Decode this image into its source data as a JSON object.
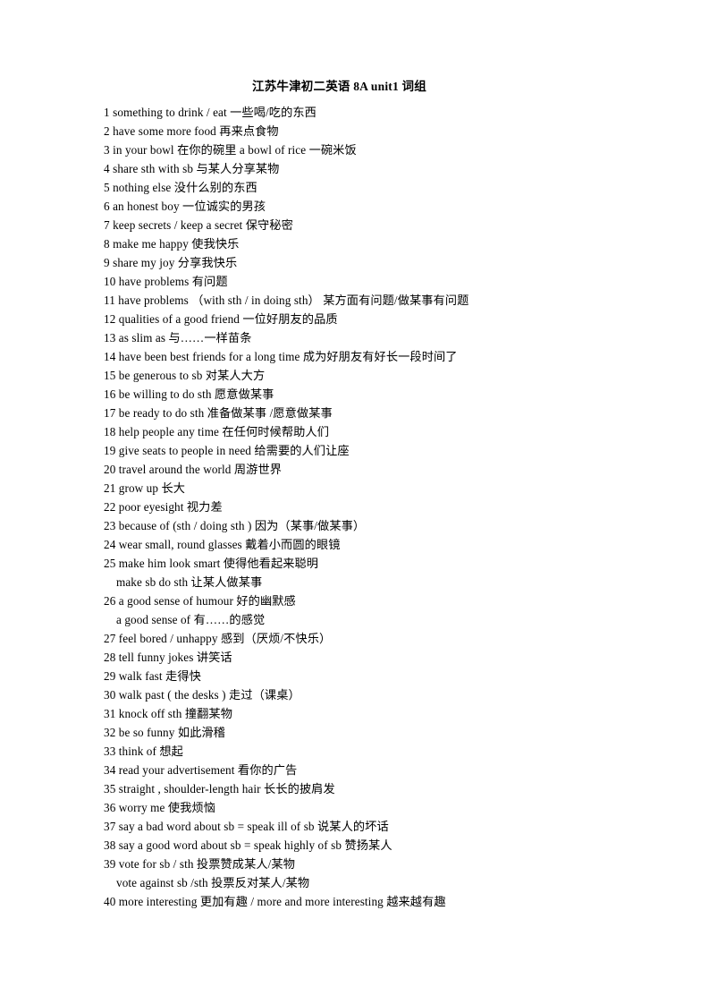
{
  "document": {
    "title_prefix": "江苏牛津初二英语 ",
    "title_bold": "8A unit1",
    "title_suffix": "  词组",
    "entries": [
      {
        "id": "1",
        "indent": false,
        "text": "1 something    to    drink / eat    一些喝/吃的东西"
      },
      {
        "id": "2",
        "indent": false,
        "text": "2 have    some    more    food    再来点食物"
      },
      {
        "id": "3",
        "indent": false,
        "text": "3 in    your    bowl    在你的碗里         a    bowl    of    rice    一碗米饭"
      },
      {
        "id": "4",
        "indent": false,
        "text": "4 share    sth    with    sb    与某人分享某物"
      },
      {
        "id": "5",
        "indent": false,
        "text": "5 nothing    else    没什么别的东西"
      },
      {
        "id": "6",
        "indent": false,
        "text": "6 an    honest    boy    一位诚实的男孩"
      },
      {
        "id": "7",
        "indent": false,
        "text": "7 keep    secrets    / keep    a    secret    保守秘密"
      },
      {
        "id": "8",
        "indent": false,
        "text": "8 make    me    happy    使我快乐"
      },
      {
        "id": "9",
        "indent": false,
        "text": "9 share    my    joy    分享我快乐"
      },
      {
        "id": "10",
        "indent": false,
        "text": "10 have    problems    有问题"
      },
      {
        "id": "11",
        "indent": false,
        "text": "11 have    problems    （with    sth / in    doing    sth）  某方面有问题/做某事有问题"
      },
      {
        "id": "12",
        "indent": false,
        "text": "12 qualities    of    a    good    friend    一位好朋友的品质"
      },
      {
        "id": "13",
        "indent": false,
        "text": "13 as    slim    as    与……一样苗条"
      },
      {
        "id": "14",
        "indent": false,
        "text": "14 have    been    best    friends    for    a    long    time    成为好朋友有好长一段时间了"
      },
      {
        "id": "15",
        "indent": false,
        "text": "15 be    generous    to    sb    对某人大方"
      },
      {
        "id": "16",
        "indent": false,
        "text": "16 be    willing    to    do    sth    愿意做某事"
      },
      {
        "id": "17",
        "indent": false,
        "text": "17 be    ready    to    do    sth    准备做某事 /愿意做某事"
      },
      {
        "id": "18",
        "indent": false,
        "text": "18 help    people    any    time    在任何时候帮助人们"
      },
      {
        "id": "19",
        "indent": false,
        "text": "19 give    seats    to    people    in    need    给需要的人们让座"
      },
      {
        "id": "20",
        "indent": false,
        "text": "20 travel    around    the    world    周游世界"
      },
      {
        "id": "21",
        "indent": false,
        "text": "21 grow    up    长大"
      },
      {
        "id": "22",
        "indent": false,
        "text": "22 poor    eyesight    视力差"
      },
      {
        "id": "23",
        "indent": false,
        "text": "23 because    of    (sth / doing    sth )  因为（某事/做某事）"
      },
      {
        "id": "24",
        "indent": false,
        "text": "24 wear    small, round    glasses    戴着小而圆的眼镜"
      },
      {
        "id": "25",
        "indent": false,
        "text": "25 make    him    look    smart    使得他看起来聪明"
      },
      {
        "id": "25b",
        "indent": true,
        "text": "make    sb    do    sth    让某人做某事"
      },
      {
        "id": "26",
        "indent": false,
        "text": "26 a    good    sense    of    humour  好的幽默感"
      },
      {
        "id": "26b",
        "indent": true,
        "text": "a    good    sense    of    有……的感觉"
      },
      {
        "id": "27",
        "indent": false,
        "text": "27 feel    bored / unhappy    感到（厌烦/不快乐）"
      },
      {
        "id": "28",
        "indent": false,
        "text": "28 tell    funny    jokes  讲笑话"
      },
      {
        "id": "29",
        "indent": false,
        "text": "29 walk    fast    走得快"
      },
      {
        "id": "30",
        "indent": false,
        "text": "30 walk    past    ( the    desks )  走过（课桌）"
      },
      {
        "id": "31",
        "indent": false,
        "text": "31 knock    off    sth    撞翻某物"
      },
      {
        "id": "32",
        "indent": false,
        "text": "32 be    so    funny    如此滑稽"
      },
      {
        "id": "33",
        "indent": false,
        "text": "33 think    of    想起"
      },
      {
        "id": "34",
        "indent": false,
        "text": "34 read    your    advertisement    看你的广告"
      },
      {
        "id": "35",
        "indent": false,
        "text": "35 straight , shoulder-length    hair  长长的披肩发"
      },
      {
        "id": "36",
        "indent": false,
        "text": "36 worry    me  使我烦恼"
      },
      {
        "id": "37",
        "indent": false,
        "text": "37 say    a    bad    word    about    sb    = speak    ill    of    sb    说某人的坏话"
      },
      {
        "id": "38",
        "indent": false,
        "text": "38 say    a    good    word    about    sb    = speak    highly    of    sb    赞扬某人"
      },
      {
        "id": "39",
        "indent": false,
        "text": "39 vote    for    sb / sth    投票赞成某人/某物"
      },
      {
        "id": "39b",
        "indent": true,
        "text": "vote    against    sb /sth    投票反对某人/某物"
      },
      {
        "id": "40",
        "indent": false,
        "text": "40 more    interesting    更加有趣 / more    and    more    interesting    越来越有趣"
      }
    ]
  }
}
